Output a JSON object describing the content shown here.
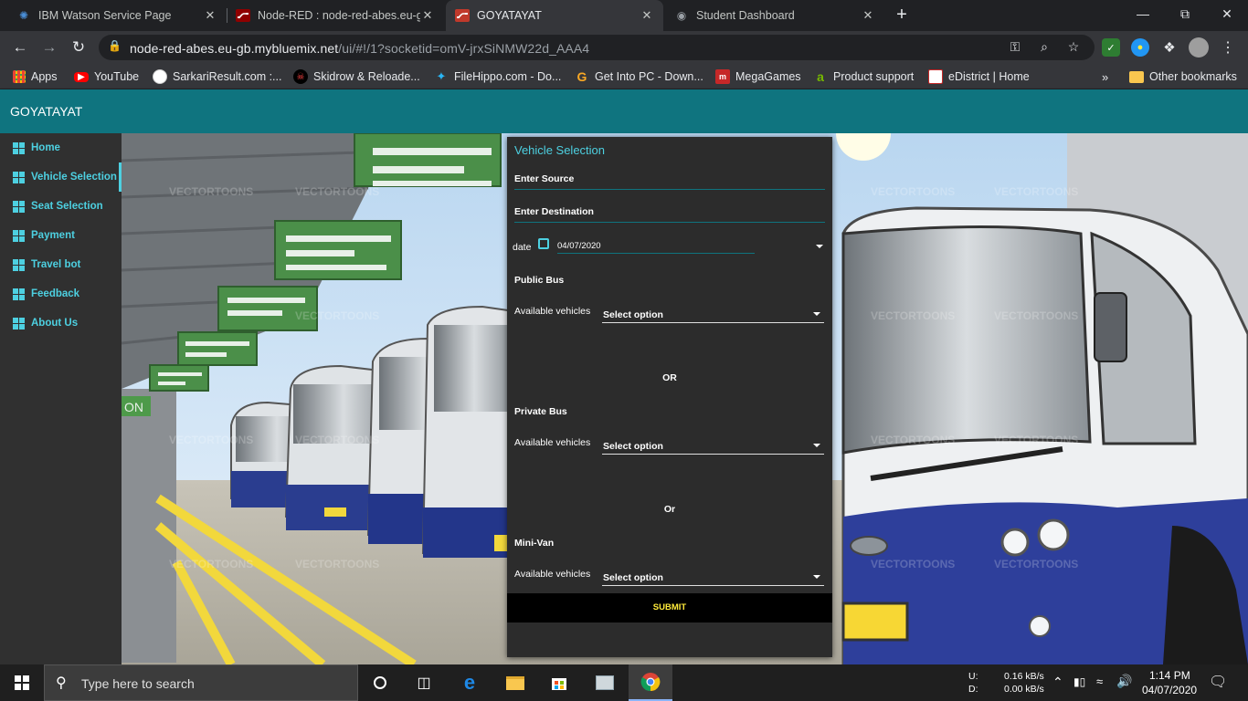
{
  "browser": {
    "tabs": [
      {
        "title": "IBM Watson Service Page",
        "icon": "ibm-watson-icon"
      },
      {
        "title": "Node-RED : node-red-abes.eu-gb",
        "icon": "node-red-icon"
      },
      {
        "title": "GOYATAYAT",
        "icon": "node-red-icon",
        "active": true
      },
      {
        "title": "Student Dashboard",
        "icon": "globe-icon"
      }
    ],
    "url_host": "node-red-abes.eu-gb.mybluemix.net",
    "url_path": "/ui/#!/1?socketid=omV-jrxSiNMW22d_AAA4",
    "bookmarks": [
      "Apps",
      "YouTube",
      "SarkariResult.com :...",
      "Skidrow & Reloade...",
      "FileHippo.com - Do...",
      "Get Into PC - Down...",
      "MegaGames",
      "Product support",
      "eDistrict | Home"
    ],
    "more_bookmarks": "»",
    "other_bookmarks": "Other bookmarks"
  },
  "app": {
    "title": "GOYATAYAT",
    "nav": [
      {
        "label": "Home"
      },
      {
        "label": "Vehicle Selection",
        "active": true
      },
      {
        "label": "Seat Selection"
      },
      {
        "label": "Payment"
      },
      {
        "label": "Travel bot"
      },
      {
        "label": "Feedback"
      },
      {
        "label": "About Us"
      }
    ],
    "accent": "#4dd0e1",
    "header_color": "#0f747f"
  },
  "form": {
    "title": "Vehicle Selection",
    "source_label": "Enter Source",
    "destination_label": "Enter Destination",
    "date_label": "date",
    "date_value": "04/07/2020",
    "public_bus": "Public Bus",
    "private_bus": "Private Bus",
    "mini_van": "Mini-Van",
    "available_vehicles": "Available vehicles",
    "select_placeholder": "Select option",
    "or_1": "OR",
    "or_2": "Or",
    "submit": "SUBMIT"
  },
  "scene": {
    "watermark": "VECTORTOONS",
    "sign_fragment": "ON"
  },
  "taskbar": {
    "search_placeholder": "Type here to search",
    "net_up_label": "U:",
    "net_down_label": "D:",
    "net_up": "0.16 kB/s",
    "net_down": "0.00 kB/s",
    "time": "1:14 PM",
    "date": "04/07/2020"
  }
}
